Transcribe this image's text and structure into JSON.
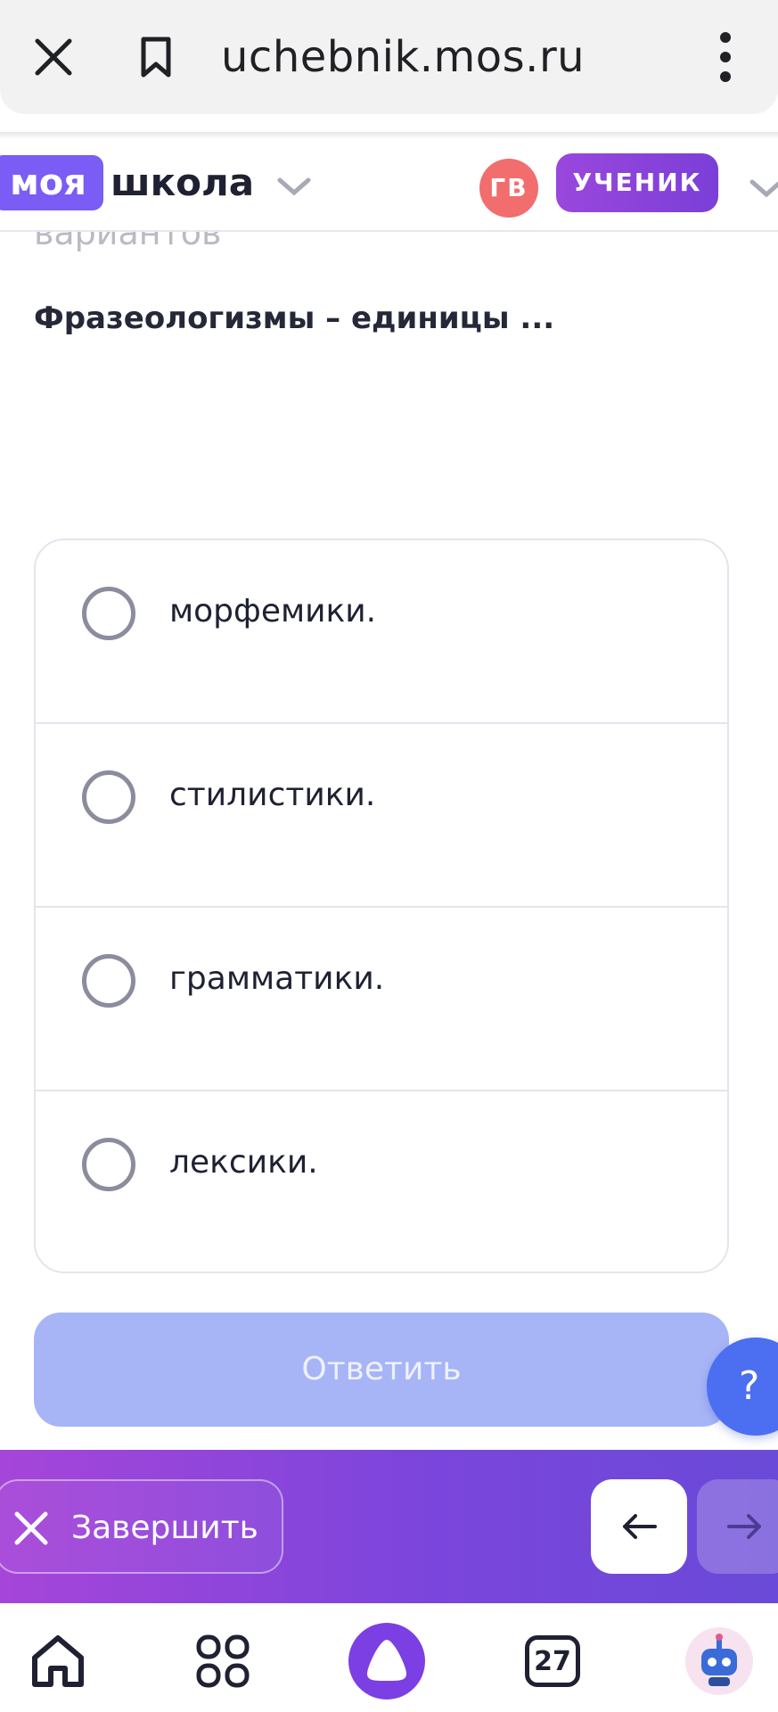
{
  "browser": {
    "url": "uchebnik.mos.ru",
    "close_icon": "close-icon",
    "bookmark_icon": "bookmark-icon",
    "menu_icon": "more-vertical-icon"
  },
  "header": {
    "logo_part1": "моя",
    "logo_part2": "школа",
    "avatar_initials": "ГВ",
    "role": "УЧЕНИК",
    "accent_color": "#7b5cf5",
    "avatar_color": "#f26d6d"
  },
  "main": {
    "faded_text": "вариантов",
    "question": "Фразеологизмы – единицы ...",
    "options": [
      {
        "label": "морфемики."
      },
      {
        "label": "стилистики."
      },
      {
        "label": "грамматики."
      },
      {
        "label": "лексики."
      }
    ],
    "answer_button": "Ответить",
    "help_button": "?"
  },
  "action_bar": {
    "finish_label": "Завершить"
  },
  "bottom_nav": {
    "tabs_count": "27",
    "items": [
      "home-icon",
      "apps-icon",
      "alice-icon",
      "tabs-icon",
      "robot-avatar-icon"
    ]
  }
}
